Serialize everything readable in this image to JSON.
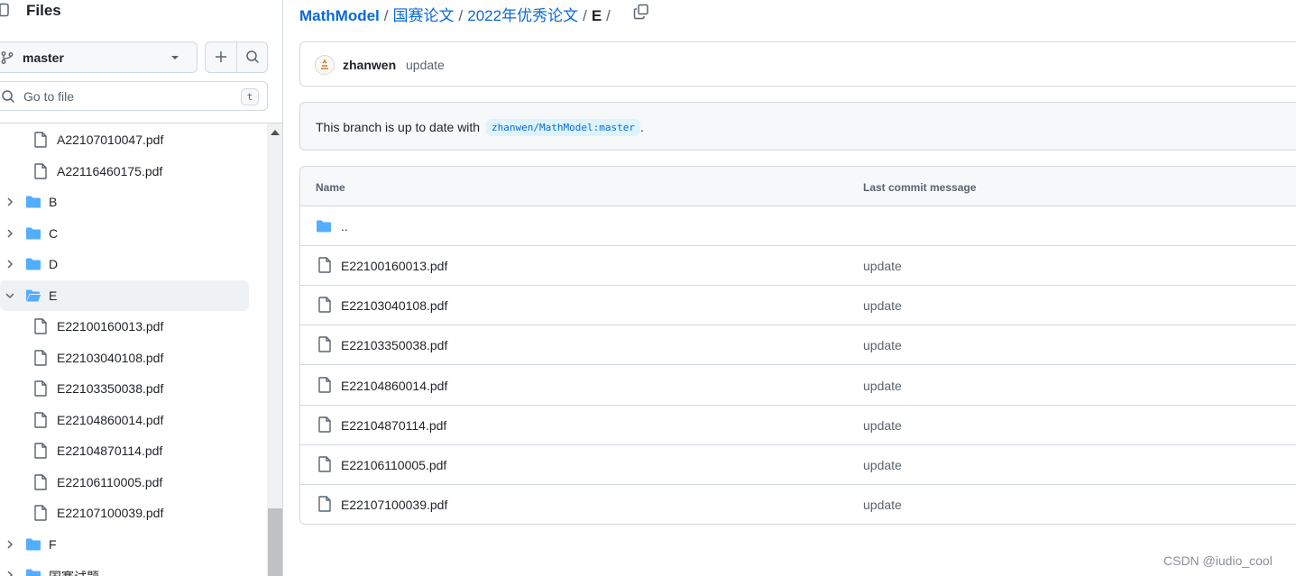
{
  "sidebar": {
    "title": "Files",
    "branch": "master",
    "goto_placeholder": "Go to file",
    "goto_shortcut": "t",
    "tree": [
      {
        "type": "file",
        "label": "A22107010047.pdf"
      },
      {
        "type": "file",
        "label": "A22116460175.pdf"
      },
      {
        "type": "folder",
        "label": "B",
        "expanded": false
      },
      {
        "type": "folder",
        "label": "C",
        "expanded": false
      },
      {
        "type": "folder",
        "label": "D",
        "expanded": false
      },
      {
        "type": "folder",
        "label": "E",
        "expanded": true,
        "selected": true
      },
      {
        "type": "file",
        "label": "E22100160013.pdf"
      },
      {
        "type": "file",
        "label": "E22103040108.pdf"
      },
      {
        "type": "file",
        "label": "E22103350038.pdf"
      },
      {
        "type": "file",
        "label": "E22104860014.pdf"
      },
      {
        "type": "file",
        "label": "E22104870114.pdf"
      },
      {
        "type": "file",
        "label": "E22106110005.pdf"
      },
      {
        "type": "file",
        "label": "E22107100039.pdf"
      },
      {
        "type": "folder",
        "label": "F",
        "expanded": false
      },
      {
        "type": "folder",
        "label": "国赛试题",
        "expanded": false
      }
    ]
  },
  "breadcrumb": {
    "root": "MathModel",
    "items": [
      "国赛论文",
      "2022年优秀论文"
    ],
    "current": "E",
    "separator": "/"
  },
  "latest_commit": {
    "author": "zhanwen",
    "message": "update"
  },
  "branch_status": {
    "text": "This branch is up to date with",
    "ref": "zhanwen/MathModel:master",
    "suffix": "."
  },
  "table": {
    "col_name": "Name",
    "col_message": "Last commit message",
    "parent_label": "..",
    "rows": [
      {
        "name": "E22100160013.pdf",
        "message": "update"
      },
      {
        "name": "E22103040108.pdf",
        "message": "update"
      },
      {
        "name": "E22103350038.pdf",
        "message": "update"
      },
      {
        "name": "E22104860014.pdf",
        "message": "update"
      },
      {
        "name": "E22104870114.pdf",
        "message": "update"
      },
      {
        "name": "E22106110005.pdf",
        "message": "update"
      },
      {
        "name": "E22107100039.pdf",
        "message": "update"
      }
    ]
  },
  "watermark": "CSDN @iudio_cool",
  "colors": {
    "accent": "#0969da",
    "folder": "#54aeff",
    "border": "#d1d9e0",
    "muted": "#59636e"
  }
}
